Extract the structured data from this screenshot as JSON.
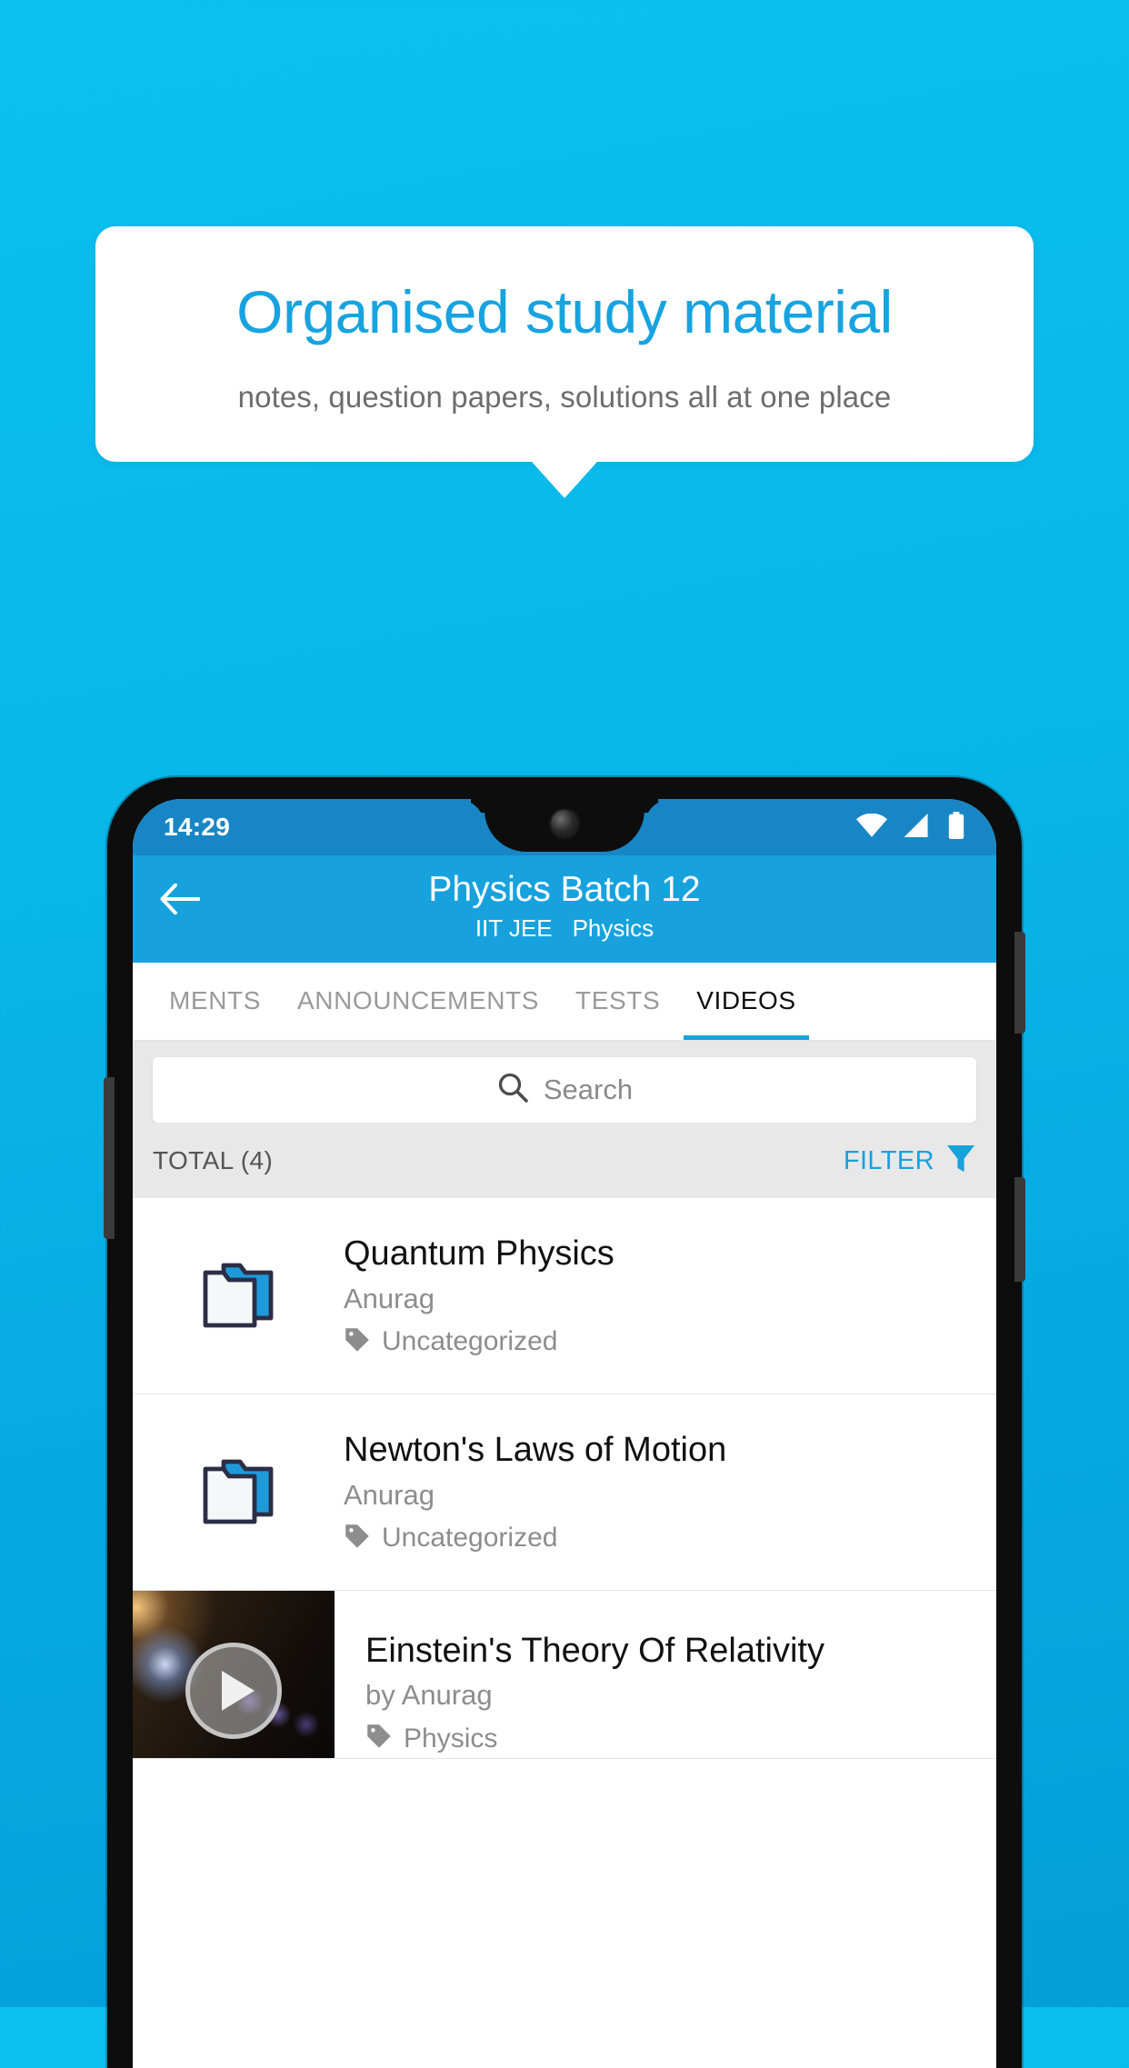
{
  "promo": {
    "title": "Organised study material",
    "subtitle": "notes, question papers, solutions all at one place",
    "accent_color": "#17a3e0",
    "background_color": "#0bc0ef"
  },
  "phone": {
    "status_bar": {
      "time": "14:29",
      "icons": [
        "wifi-icon",
        "signal-icon",
        "battery-icon"
      ]
    },
    "app_bar": {
      "back_icon": "back-arrow-icon",
      "title": "Physics Batch 12",
      "subtitle_exam": "IIT JEE",
      "subtitle_subject": "Physics",
      "color": "#17a2dd"
    },
    "tabs": [
      {
        "label": "MENTS",
        "active": false
      },
      {
        "label": "ANNOUNCEMENTS",
        "active": false
      },
      {
        "label": "TESTS",
        "active": false
      },
      {
        "label": "VIDEOS",
        "active": true
      }
    ],
    "search": {
      "icon": "search-icon",
      "placeholder": "Search",
      "value": ""
    },
    "toolbar": {
      "total_label": "TOTAL (4)",
      "filter_label": "FILTER",
      "filter_icon": "filter-funnel-icon",
      "filter_color": "#17a2dd"
    },
    "items": [
      {
        "icon": "folder-icon",
        "title": "Quantum Physics",
        "author": "Anurag",
        "tag_icon": "tag-icon",
        "tag": "Uncategorized",
        "type": "folder"
      },
      {
        "icon": "folder-icon",
        "title": "Newton's Laws of Motion",
        "author": "Anurag",
        "tag_icon": "tag-icon",
        "tag": "Uncategorized",
        "type": "folder"
      },
      {
        "icon": "video-thumbnail",
        "title": "Einstein's Theory Of Relativity",
        "author": "by Anurag",
        "tag_icon": "tag-icon",
        "tag": "Physics",
        "type": "video"
      }
    ]
  }
}
